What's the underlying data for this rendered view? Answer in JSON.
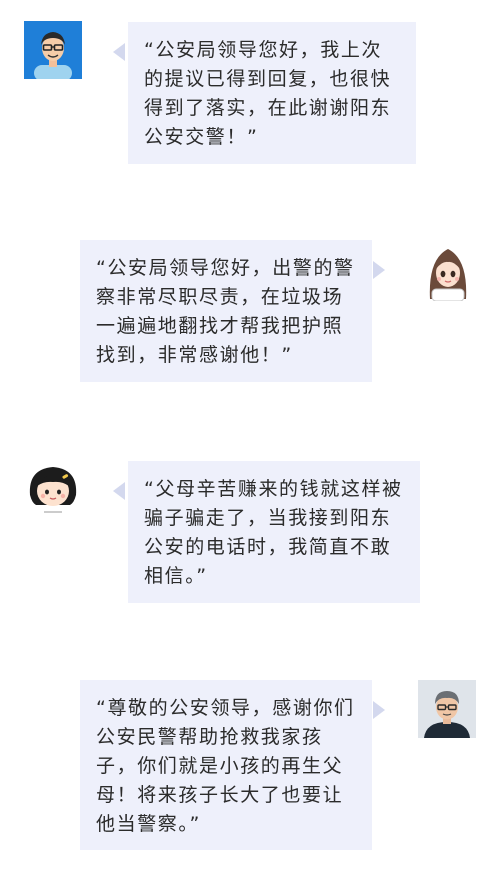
{
  "messages": [
    {
      "id": "msg1",
      "side": "left",
      "avatar": "man-glasses-avatar-icon",
      "text": "“公安局领导您好，我上次的提议已得到回复，也很快得到了落实，在此谢谢阳东公安交警！”"
    },
    {
      "id": "msg2",
      "side": "right",
      "avatar": "girl-long-hair-avatar-icon",
      "text": "“公安局领导您好，出警的警察非常尽职尽责，在垃圾场一遍遍地翻找才帮我把护照找到，非常感谢他！”"
    },
    {
      "id": "msg3",
      "side": "left",
      "avatar": "girl-bob-hair-avatar-icon",
      "text": "“父母辛苦赚来的钱就这样被骗子骗走了，当我接到阳东公安的电话时，我简直不敢相信。”"
    },
    {
      "id": "msg4",
      "side": "right",
      "avatar": "man-short-hair-avatar-icon",
      "text": "“尊敬的公安领导，感谢你们公安民警帮助抢救我家孩子，你们就是小孩的再生父母！将来孩子长大了也要让他当警察。”"
    }
  ],
  "colors": {
    "bubble_bg": "#eef0fb",
    "tail": "#d3d8ee",
    "text": "#2b2b2b"
  }
}
